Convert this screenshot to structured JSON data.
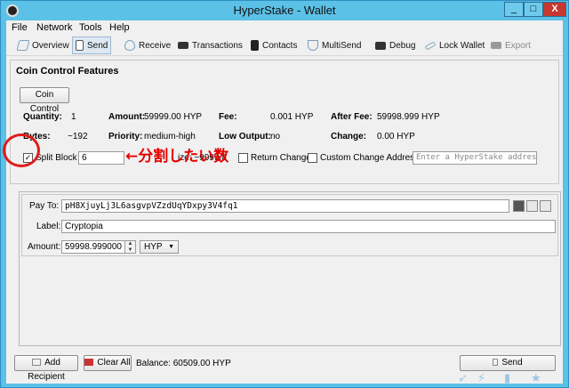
{
  "window": {
    "title": "HyperStake - Wallet",
    "min_label": "_",
    "max_label": "□",
    "close_label": "X"
  },
  "menu": [
    "File",
    "Network",
    "Tools",
    "Help"
  ],
  "toolbar": {
    "overview": "Overview",
    "send": "Send",
    "receive": "Receive",
    "transactions": "Transactions",
    "contacts": "Contacts",
    "multisend": "MultiSend",
    "debug": "Debug",
    "lock_wallet": "Lock Wallet",
    "export": "Export"
  },
  "coin_control": {
    "title": "Coin Control Features",
    "button": "Coin Control",
    "quantity_label": "Quantity:",
    "quantity": "1",
    "amount_label": "Amount:",
    "amount": "59999.00 HYP",
    "fee_label": "Fee:",
    "fee": "0.001 HYP",
    "after_fee_label": "After Fee:",
    "after_fee": "59998.999 HYP",
    "bytes_label": "Bytes:",
    "bytes": "~192",
    "priority_label": "Priority:",
    "priority": "medium-high",
    "low_output_label": "Low Output:",
    "low_output": "no",
    "change_label": "Change:",
    "change": "0.00 HYP",
    "split_block_label": "Split Block",
    "split_block_value": "6",
    "size_fragment": "ize: ~9999.8",
    "return_change_label": "Return Change",
    "custom_change_label": "Custom Change Address",
    "custom_change_placeholder": "Enter a HyperStake addres..."
  },
  "annotation": "←分割したい数",
  "entry": {
    "pay_to_label": "Pay To:",
    "pay_to": "pH8XjuyLj3L6asgvpVZzdUqYDxpy3V4fq1",
    "label_label": "Label:",
    "label": "Cryptopia",
    "amount_label": "Amount:",
    "amount": "59998.999000",
    "unit": "HYP"
  },
  "bottom": {
    "add_recipient": "Add Recipient",
    "clear_all": "Clear All",
    "balance": "Balance: 60509.00 HYP",
    "send": "Send"
  }
}
